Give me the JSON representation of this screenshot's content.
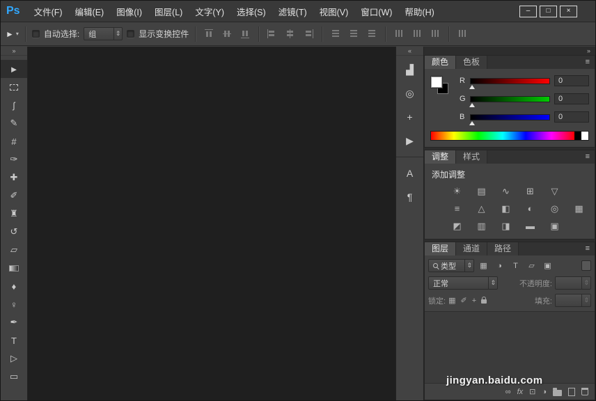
{
  "window": {
    "title_logo": "Ps",
    "menu_items": [
      "文件(F)",
      "编辑(E)",
      "图像(I)",
      "图层(L)",
      "文字(Y)",
      "选择(S)",
      "滤镜(T)",
      "视图(V)",
      "窗口(W)",
      "帮助(H)"
    ],
    "controls": {
      "minimize": "–",
      "restore": "□",
      "close": "×"
    }
  },
  "icons": {
    "tool_preset_move": "►",
    "tool_preset_caret": "▾",
    "combo_arrows": "⇕",
    "panel_menu": "≡",
    "collapse_left": "«",
    "collapse_right": "»"
  },
  "options_bar": {
    "auto_select_label": "自动选择:",
    "auto_select_value": "组",
    "show_transform_label": "显示变换控件"
  },
  "toolbar": {
    "tools": [
      {
        "name": "move",
        "glyph": "►"
      },
      {
        "name": "rectangular-marquee",
        "glyph": ""
      },
      {
        "name": "lasso",
        "glyph": "ʃ"
      },
      {
        "name": "quick-selection",
        "glyph": "✎"
      },
      {
        "name": "crop",
        "glyph": "#"
      },
      {
        "name": "eyedropper",
        "glyph": "✑"
      },
      {
        "name": "spot-healing-brush",
        "glyph": "✚"
      },
      {
        "name": "brush",
        "glyph": "✐"
      },
      {
        "name": "clone-stamp",
        "glyph": "♜"
      },
      {
        "name": "history-brush",
        "glyph": "↺"
      },
      {
        "name": "eraser",
        "glyph": "▱"
      },
      {
        "name": "gradient",
        "glyph": ""
      },
      {
        "name": "blur",
        "glyph": "♦"
      },
      {
        "name": "dodge",
        "glyph": "♀"
      },
      {
        "name": "pen",
        "glyph": "✒"
      },
      {
        "name": "type",
        "glyph": "T"
      },
      {
        "name": "path-selection",
        "glyph": "▷"
      },
      {
        "name": "rectangle",
        "glyph": "▭"
      }
    ]
  },
  "dock_strip": {
    "panels": [
      {
        "name": "histogram",
        "glyph": "▟"
      },
      {
        "name": "navigator",
        "glyph": "◎"
      },
      {
        "name": "info",
        "glyph": "+"
      },
      {
        "name": "actions",
        "glyph": "▶"
      },
      {
        "name": "character",
        "glyph": "A"
      },
      {
        "name": "paragraph",
        "glyph": "¶"
      }
    ]
  },
  "color_panel": {
    "tabs": [
      "颜色",
      "色板"
    ],
    "foreground_color": "#ffffff",
    "background_color": "#000000",
    "channels": [
      {
        "label": "R",
        "value": "0",
        "color": "#ff0000"
      },
      {
        "label": "G",
        "value": "0",
        "color": "#00cc00"
      },
      {
        "label": "B",
        "value": "0",
        "color": "#0000ff"
      }
    ]
  },
  "adjustments_panel": {
    "tabs": [
      "调整",
      "样式"
    ],
    "title": "添加调整",
    "rows": [
      [
        {
          "name": "brightness-contrast",
          "glyph": "☀"
        },
        {
          "name": "levels",
          "glyph": "▤"
        },
        {
          "name": "curves",
          "glyph": "∿"
        },
        {
          "name": "exposure",
          "glyph": "⊞"
        },
        {
          "name": "vibrance",
          "glyph": "▽"
        }
      ],
      [
        {
          "name": "hue-saturation",
          "glyph": "≡"
        },
        {
          "name": "color-balance",
          "glyph": "△"
        },
        {
          "name": "black-white",
          "glyph": "◧"
        },
        {
          "name": "photo-filter",
          "glyph": "◐"
        },
        {
          "name": "channel-mixer",
          "glyph": "◎"
        },
        {
          "name": "color-lookup",
          "glyph": "▦"
        }
      ],
      [
        {
          "name": "invert",
          "glyph": "◩"
        },
        {
          "name": "posterize",
          "glyph": "▥"
        },
        {
          "name": "threshold",
          "glyph": "◨"
        },
        {
          "name": "gradient-map",
          "glyph": "▬"
        },
        {
          "name": "selective-color",
          "glyph": "▣"
        }
      ]
    ]
  },
  "layers_panel": {
    "tabs": [
      "图层",
      "通道",
      "路径"
    ],
    "filter_label": "类型",
    "filter_type_icons": [
      {
        "name": "pixel-layers",
        "glyph": "▦"
      },
      {
        "name": "adjustment-layers",
        "glyph": "◑"
      },
      {
        "name": "type-layers",
        "glyph": "T"
      },
      {
        "name": "shape-layers",
        "glyph": "▱"
      },
      {
        "name": "smart-objects",
        "glyph": "▣"
      }
    ],
    "blend_mode": "正常",
    "opacity_label": "不透明度:",
    "opacity_value": "",
    "lock_label": "锁定:",
    "lock_icons": [
      {
        "name": "lock-transparent-pixels",
        "glyph": "▦"
      },
      {
        "name": "lock-paint",
        "glyph": "✐"
      },
      {
        "name": "lock-position",
        "glyph": "+"
      },
      {
        "name": "lock-all",
        "glyph": ""
      }
    ],
    "fill_label": "填充:",
    "fill_value": "",
    "footer_icons": [
      {
        "name": "link-layers",
        "glyph": "∞"
      },
      {
        "name": "layer-effects",
        "glyph": "fx"
      },
      {
        "name": "layer-mask",
        "glyph": "⊡"
      },
      {
        "name": "adjustment-layer",
        "glyph": "◑"
      },
      {
        "name": "new-group",
        "glyph": ""
      },
      {
        "name": "new-layer",
        "glyph": ""
      },
      {
        "name": "delete-layer",
        "glyph": ""
      }
    ]
  },
  "watermark": "jingyan.baidu.com"
}
